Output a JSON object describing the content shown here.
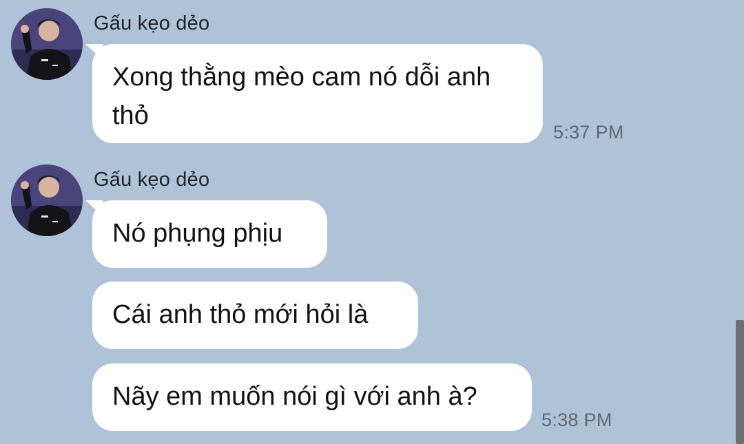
{
  "messages": [
    {
      "sender": "Gấu kẹo dẻo",
      "avatar_icon": "user-photo-avatar",
      "bubbles": [
        {
          "text": "Xong thằng mèo cam nó dỗi anh thỏ"
        }
      ],
      "time": "5:37 PM"
    },
    {
      "sender": "Gấu kẹo dẻo",
      "avatar_icon": "user-photo-avatar",
      "bubbles": [
        {
          "text": "Nó phụng phịu"
        },
        {
          "text": "Cái anh thỏ mới hỏi là"
        },
        {
          "text": "Nãy em muốn nói gì với anh à?"
        }
      ],
      "time": "5:38 PM"
    }
  ],
  "colors": {
    "background": "#aec3d8",
    "bubble": "#ffffff",
    "scrollbar": "#6b6f75"
  }
}
